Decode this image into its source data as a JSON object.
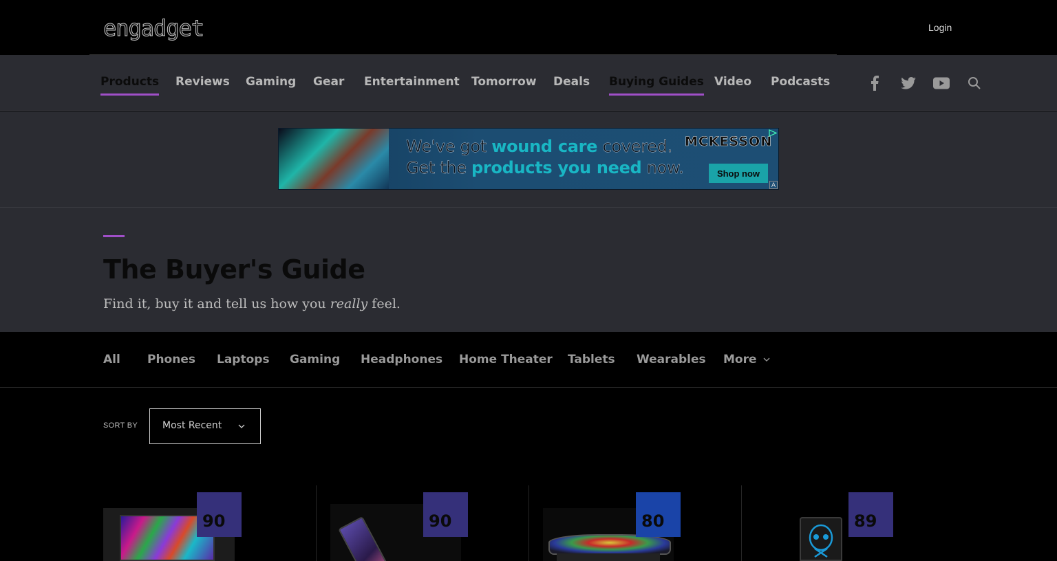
{
  "header": {
    "logo_text": "engadget",
    "login_label": "Login"
  },
  "nav": {
    "items": [
      {
        "label": "Products",
        "active": true
      },
      {
        "label": "Reviews",
        "active": false
      },
      {
        "label": "Gaming",
        "active": false
      },
      {
        "label": "Gear",
        "active": false
      },
      {
        "label": "Entertainment",
        "active": false
      },
      {
        "label": "Tomorrow",
        "active": false
      },
      {
        "label": "Deals",
        "active": false
      },
      {
        "label": "Buying Guides",
        "active": true
      },
      {
        "label": "Video",
        "active": false
      },
      {
        "label": "Podcasts",
        "active": false
      }
    ],
    "social": [
      "facebook-icon",
      "twitter-icon",
      "youtube-icon",
      "search-icon"
    ],
    "accent_color": "#a04fc8"
  },
  "ad": {
    "line1_pre": "We've got ",
    "line1_hl": "wound care",
    "line1_post": " covered.",
    "line2_pre": "Get the ",
    "line2_hl": "products you need",
    "line2_post": " now.",
    "brand": "MCKESSON",
    "cta": "Shop now",
    "badge": "A"
  },
  "hero": {
    "title": "The Buyer's Guide",
    "subtitle_pre": "Find it, buy it and tell us how you ",
    "subtitle_em": "really",
    "subtitle_post": " feel."
  },
  "categories": [
    "All",
    "Phones",
    "Laptops",
    "Gaming",
    "Headphones",
    "Home Theater",
    "Tablets",
    "Wearables",
    "More"
  ],
  "sort": {
    "label": "SORT BY",
    "selected": "Most Recent"
  },
  "products": [
    {
      "score": "90",
      "score_color": "#35307a"
    },
    {
      "score": "90",
      "score_color": "#35307a"
    },
    {
      "score": "80",
      "score_color": "#1a44a8"
    },
    {
      "score": "89",
      "score_color": "#35307a"
    }
  ]
}
